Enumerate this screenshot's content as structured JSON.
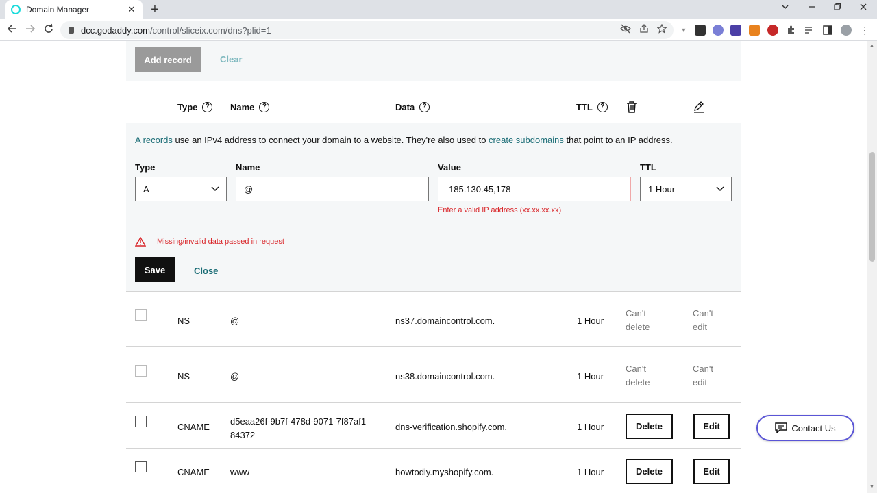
{
  "browser": {
    "tab_title": "Domain Manager",
    "close_glyph": "✕",
    "new_tab_glyph": "+",
    "url_host": "dcc.godaddy.com",
    "url_path": "/control/sliceix.com/dns?plid=1"
  },
  "toolbar": {
    "add_record_label": "Add record",
    "clear_label": "Clear"
  },
  "table_header": {
    "type": "Type",
    "name": "Name",
    "data": "Data",
    "ttl": "TTL",
    "help_glyph": "?"
  },
  "editor": {
    "info_link1": "A records",
    "info_text1": " use an IPv4 address to connect your domain to a website. They're also used to ",
    "info_link2": "create subdomains",
    "info_text2": " that point to an IP address.",
    "type_label": "Type",
    "type_value": "A",
    "name_label": "Name",
    "name_value": "@",
    "value_label": "Value",
    "value_value": "185.130.45,178",
    "value_error": "Enter a valid IP address (xx.xx.xx.xx)",
    "ttl_label": "TTL",
    "ttl_value": "1 Hour",
    "form_error": "Missing/invalid data passed in request",
    "save_label": "Save",
    "close_label": "Close"
  },
  "records": [
    {
      "type": "NS",
      "name": "@",
      "name2": "",
      "data": "ns37.domaincontrol.com.",
      "ttl": "1 Hour",
      "delete": "Can't delete",
      "edit": "Can't edit"
    },
    {
      "type": "NS",
      "name": "@",
      "name2": "",
      "data": "ns38.domaincontrol.com.",
      "ttl": "1 Hour",
      "delete": "Can't delete",
      "edit": "Can't edit"
    },
    {
      "type": "CNAME",
      "name": "d5eaa26f-9b7f-478d-9071-7f87af1",
      "name2": "84372",
      "data": "dns-verification.shopify.com.",
      "ttl": "1 Hour",
      "delete": "Delete",
      "edit": "Edit"
    },
    {
      "type": "CNAME",
      "name": "www",
      "name2": "",
      "data": "howtodiy.myshopify.com.",
      "ttl": "1 Hour",
      "delete": "Delete",
      "edit": "Edit"
    }
  ],
  "contact": {
    "label": "Contact Us"
  },
  "colors": {
    "accent_teal": "#1b6d76",
    "error_red": "#d9262a",
    "contact_border": "#5a55d6"
  }
}
